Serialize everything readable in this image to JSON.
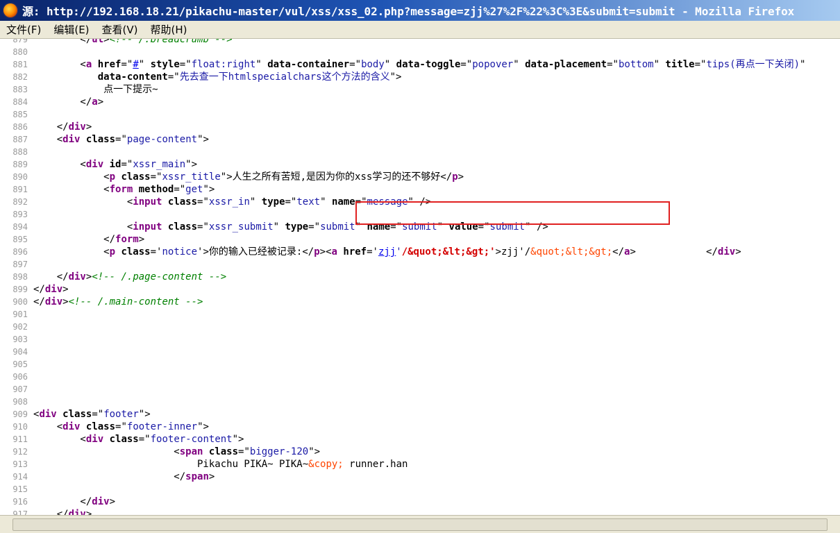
{
  "window": {
    "title": "源: http://192.168.18.21/pikachu-master/vul/xss/xss_02.php?message=zjj%27%2F%22%3C%3E&submit=submit - Mozilla Firefox",
    "icon": "firefox-icon"
  },
  "menu": [
    "文件(F)",
    "编辑(E)",
    "查看(V)",
    "帮助(H)"
  ],
  "lines": [
    {
      "n": "879",
      "segs": [
        [
          "t",
          "        </"
        ],
        [
          "tag",
          "ul"
        ],
        [
          "t",
          ">"
        ],
        [
          "cmt",
          "<!-- /.breadcrumb -->"
        ]
      ]
    },
    {
      "n": "880",
      "segs": []
    },
    {
      "n": "881",
      "segs": [
        [
          "t",
          "        <"
        ],
        [
          "tag",
          "a"
        ],
        [
          "t",
          " "
        ],
        [
          "attr",
          "href"
        ],
        [
          "t",
          "=\""
        ],
        [
          "link",
          "#"
        ],
        [
          "t",
          "\" "
        ],
        [
          "attr",
          "style"
        ],
        [
          "t",
          "=\""
        ],
        [
          "val",
          "float:right"
        ],
        [
          "t",
          "\" "
        ],
        [
          "attr",
          "data-container"
        ],
        [
          "t",
          "=\""
        ],
        [
          "val",
          "body"
        ],
        [
          "t",
          "\" "
        ],
        [
          "attr",
          "data-toggle"
        ],
        [
          "t",
          "=\""
        ],
        [
          "val",
          "popover"
        ],
        [
          "t",
          "\" "
        ],
        [
          "attr",
          "data-placement"
        ],
        [
          "t",
          "=\""
        ],
        [
          "val",
          "bottom"
        ],
        [
          "t",
          "\" "
        ],
        [
          "attr",
          "title"
        ],
        [
          "t",
          "=\""
        ],
        [
          "val",
          "tips(再点一下关闭)"
        ],
        [
          "t",
          "\""
        ]
      ]
    },
    {
      "n": "882",
      "segs": [
        [
          "t",
          "           "
        ],
        [
          "attr",
          "data-content"
        ],
        [
          "t",
          "=\""
        ],
        [
          "val",
          "先去查一下htmlspecialchars这个方法的含义"
        ],
        [
          "t",
          "\">"
        ]
      ]
    },
    {
      "n": "883",
      "segs": [
        [
          "t",
          "            点一下提示~"
        ]
      ]
    },
    {
      "n": "884",
      "segs": [
        [
          "t",
          "        </"
        ],
        [
          "tag",
          "a"
        ],
        [
          "t",
          ">"
        ]
      ]
    },
    {
      "n": "885",
      "segs": []
    },
    {
      "n": "886",
      "segs": [
        [
          "t",
          "    </"
        ],
        [
          "tag",
          "div"
        ],
        [
          "t",
          ">"
        ]
      ]
    },
    {
      "n": "887",
      "segs": [
        [
          "t",
          "    <"
        ],
        [
          "tag",
          "div"
        ],
        [
          "t",
          " "
        ],
        [
          "attr",
          "class"
        ],
        [
          "t",
          "=\""
        ],
        [
          "val",
          "page-content"
        ],
        [
          "t",
          "\">"
        ]
      ]
    },
    {
      "n": "888",
      "segs": []
    },
    {
      "n": "889",
      "segs": [
        [
          "t",
          "        <"
        ],
        [
          "tag",
          "div"
        ],
        [
          "t",
          " "
        ],
        [
          "attr",
          "id"
        ],
        [
          "t",
          "=\""
        ],
        [
          "val",
          "xssr_main"
        ],
        [
          "t",
          "\">"
        ]
      ]
    },
    {
      "n": "890",
      "segs": [
        [
          "t",
          "            <"
        ],
        [
          "tag",
          "p"
        ],
        [
          "t",
          " "
        ],
        [
          "attr",
          "class"
        ],
        [
          "t",
          "=\""
        ],
        [
          "val",
          "xssr_title"
        ],
        [
          "t",
          "\">人生之所有苦短,是因为你的xss学习的还不够好</"
        ],
        [
          "tag",
          "p"
        ],
        [
          "t",
          ">"
        ]
      ]
    },
    {
      "n": "891",
      "segs": [
        [
          "t",
          "            <"
        ],
        [
          "tag",
          "form"
        ],
        [
          "t",
          " "
        ],
        [
          "attr",
          "method"
        ],
        [
          "t",
          "=\""
        ],
        [
          "val",
          "get"
        ],
        [
          "t",
          "\">"
        ]
      ]
    },
    {
      "n": "892",
      "segs": [
        [
          "t",
          "                <"
        ],
        [
          "tag",
          "input"
        ],
        [
          "t",
          " "
        ],
        [
          "attr",
          "class"
        ],
        [
          "t",
          "=\""
        ],
        [
          "val",
          "xssr_in"
        ],
        [
          "t",
          "\" "
        ],
        [
          "attr",
          "type"
        ],
        [
          "t",
          "=\""
        ],
        [
          "val",
          "text"
        ],
        [
          "t",
          "\" "
        ],
        [
          "attr",
          "name"
        ],
        [
          "t",
          "=\""
        ],
        [
          "val",
          "message"
        ],
        [
          "t",
          "\" />"
        ]
      ]
    },
    {
      "n": "893",
      "segs": []
    },
    {
      "n": "894",
      "segs": [
        [
          "t",
          "                <"
        ],
        [
          "tag",
          "input"
        ],
        [
          "t",
          " "
        ],
        [
          "attr",
          "class"
        ],
        [
          "t",
          "=\""
        ],
        [
          "val",
          "xssr_submit"
        ],
        [
          "t",
          "\" "
        ],
        [
          "attr",
          "type"
        ],
        [
          "t",
          "=\""
        ],
        [
          "val",
          "submit"
        ],
        [
          "t",
          "\" "
        ],
        [
          "attr",
          "name"
        ],
        [
          "t",
          "=\""
        ],
        [
          "val",
          "submit"
        ],
        [
          "t",
          "\" "
        ],
        [
          "attr",
          "value"
        ],
        [
          "t",
          "=\""
        ],
        [
          "val",
          "submit"
        ],
        [
          "t",
          "\" />"
        ]
      ]
    },
    {
      "n": "895",
      "segs": [
        [
          "t",
          "            </"
        ],
        [
          "tag",
          "form"
        ],
        [
          "t",
          ">"
        ]
      ]
    },
    {
      "n": "896",
      "segs": [
        [
          "t",
          "            <"
        ],
        [
          "tag",
          "p"
        ],
        [
          "t",
          " "
        ],
        [
          "attr",
          "class"
        ],
        [
          "t",
          "='"
        ],
        [
          "val",
          "notice"
        ],
        [
          "t",
          "'>你的输入已经被记录:</"
        ],
        [
          "tag",
          "p"
        ],
        [
          "t",
          ">"
        ],
        [
          "t",
          "<"
        ],
        [
          "tag",
          "a"
        ],
        [
          "t",
          " "
        ],
        [
          "attr",
          "href"
        ],
        [
          "t",
          "='"
        ],
        [
          "link",
          "zjj"
        ],
        [
          "val",
          "'"
        ],
        [
          "hl-red",
          "/&quot;&lt;&gt;'"
        ],
        [
          "t",
          ">zjj'/"
        ],
        [
          "ent",
          "&quot;&lt;&gt;"
        ],
        [
          "t",
          "</"
        ],
        [
          "tag",
          "a"
        ],
        [
          "t",
          ">            </"
        ],
        [
          "tag",
          "div"
        ],
        [
          "t",
          ">"
        ]
      ]
    },
    {
      "n": "897",
      "segs": []
    },
    {
      "n": "898",
      "segs": [
        [
          "t",
          "    </"
        ],
        [
          "tag",
          "div"
        ],
        [
          "t",
          ">"
        ],
        [
          "cmt",
          "<!-- /.page-content -->"
        ]
      ]
    },
    {
      "n": "899",
      "segs": [
        [
          "t",
          "</"
        ],
        [
          "tag",
          "div"
        ],
        [
          "t",
          ">"
        ]
      ]
    },
    {
      "n": "900",
      "segs": [
        [
          "t",
          "</"
        ],
        [
          "tag",
          "div"
        ],
        [
          "t",
          ">"
        ],
        [
          "cmt",
          "<!-- /.main-content -->"
        ]
      ]
    },
    {
      "n": "901",
      "segs": []
    },
    {
      "n": "902",
      "segs": []
    },
    {
      "n": "903",
      "segs": []
    },
    {
      "n": "904",
      "segs": []
    },
    {
      "n": "905",
      "segs": []
    },
    {
      "n": "906",
      "segs": []
    },
    {
      "n": "907",
      "segs": []
    },
    {
      "n": "908",
      "segs": []
    },
    {
      "n": "909",
      "segs": [
        [
          "t",
          "<"
        ],
        [
          "tag",
          "div"
        ],
        [
          "t",
          " "
        ],
        [
          "attr",
          "class"
        ],
        [
          "t",
          "=\""
        ],
        [
          "val",
          "footer"
        ],
        [
          "t",
          "\">"
        ]
      ]
    },
    {
      "n": "910",
      "segs": [
        [
          "t",
          "    <"
        ],
        [
          "tag",
          "div"
        ],
        [
          "t",
          " "
        ],
        [
          "attr",
          "class"
        ],
        [
          "t",
          "=\""
        ],
        [
          "val",
          "footer-inner"
        ],
        [
          "t",
          "\">"
        ]
      ]
    },
    {
      "n": "911",
      "segs": [
        [
          "t",
          "        <"
        ],
        [
          "tag",
          "div"
        ],
        [
          "t",
          " "
        ],
        [
          "attr",
          "class"
        ],
        [
          "t",
          "=\""
        ],
        [
          "val",
          "footer-content"
        ],
        [
          "t",
          "\">"
        ]
      ]
    },
    {
      "n": "912",
      "segs": [
        [
          "t",
          "                        <"
        ],
        [
          "tag",
          "span"
        ],
        [
          "t",
          " "
        ],
        [
          "attr",
          "class"
        ],
        [
          "t",
          "=\""
        ],
        [
          "val",
          "bigger-120"
        ],
        [
          "t",
          "\">"
        ]
      ]
    },
    {
      "n": "913",
      "segs": [
        [
          "t",
          "                            Pikachu PIKA~ PIKA~"
        ],
        [
          "ent",
          "&copy;"
        ],
        [
          "t",
          " runner.han"
        ]
      ]
    },
    {
      "n": "914",
      "segs": [
        [
          "t",
          "                        </"
        ],
        [
          "tag",
          "span"
        ],
        [
          "t",
          ">"
        ]
      ]
    },
    {
      "n": "915",
      "segs": []
    },
    {
      "n": "916",
      "segs": [
        [
          "t",
          "        </"
        ],
        [
          "tag",
          "div"
        ],
        [
          "t",
          ">"
        ]
      ]
    },
    {
      "n": "917",
      "segs": [
        [
          "t",
          "    </"
        ],
        [
          "tag",
          "div"
        ],
        [
          "t",
          ">"
        ]
      ]
    }
  ]
}
